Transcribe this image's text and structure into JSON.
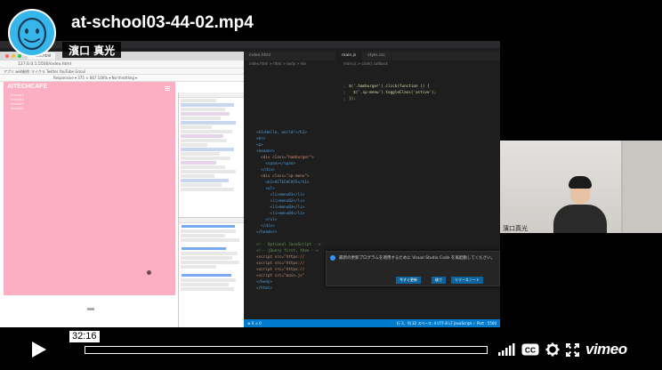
{
  "video": {
    "title": "at-school03-44-02.mp4",
    "author": "濱口 真光",
    "time_tooltip": "32:16",
    "progress": 0.0,
    "brand": "vimeo"
  },
  "controls": {
    "play": "play",
    "volume": "volume",
    "cc": "CC",
    "settings": "settings",
    "fullscreen": "fullscreen"
  },
  "recording": {
    "webcam_name": "濱口真光",
    "preview_site_title": "AITECHCAFE",
    "preview_menu": [
      "menu01",
      "menu02",
      "menu03",
      "menu04"
    ],
    "browser": {
      "tab_label": "index.html",
      "url": "127.0.0.1:5500/index.html",
      "bookmarks": "アプリ   web制作   マイクラ   Twitter   YouTube   Gmail",
      "device_bar": "Responsive ▾   375  ×  667   100% ▾   No throttling ▾"
    },
    "vscode": {
      "tabs": [
        "index.html",
        "main.js",
        "style.css"
      ],
      "active_tab": "main.js",
      "breadcrumb_left": "index.html > html > body > div",
      "breadcrumb_right": "main.js > click() callback",
      "html_code": [
        "<h1>Hello, world!</h1>",
        "<hr>",
        "<p>",
        "<header>",
        "  <div class=\"hamburger\">",
        "    <span></span>",
        "  </div>",
        "  <div class=\"sp-menu\">",
        "    <h1>AITECHCAFE</h1>",
        "    <ul>",
        "      <li>menu01</li>",
        "      <li>menu02</li>",
        "      <li>menu03</li>",
        "      <li>menu04</li>",
        "    </ul>",
        "  </div>",
        "</header>",
        "",
        "<!-- Optional JavaScript -->",
        "<!-- jQuery first, then -->",
        "<script src=\"https://",
        "<script src=\"https://",
        "<script src=\"https://",
        "<script src=\"main.js\"",
        "</body>",
        "</html>"
      ],
      "js_code": [
        "$('.hamburger').click(function () {",
        "  $('.sp-menu').toggleClass('active');",
        "});"
      ],
      "notice_text": "最新の更新プログラムを適用するために Visual Studio Code を再起動してください。",
      "notice_buttons": [
        "今すぐ更新",
        "後で",
        "リリースノート"
      ],
      "status_left": "⊗ 0 ⚠ 0",
      "status_right": "行 3、列 32   スペース: 4   UTF-8   LF   JavaScript   ✓ Port : 5500"
    },
    "devtools": {
      "panel_tabs": "Elements  Console  Sources",
      "console_title": "Console   What's New ×",
      "whats_new": "Highlights from the Chrome 81 update"
    }
  }
}
